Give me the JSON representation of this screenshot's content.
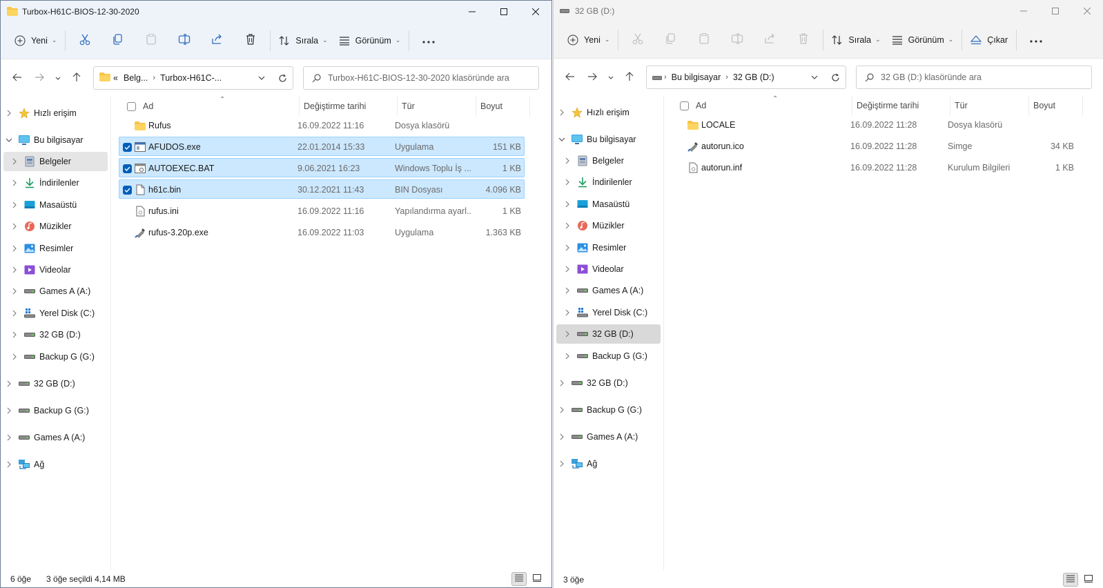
{
  "left": {
    "title": "Turbox-H61C-BIOS-12-30-2020",
    "toolbar": {
      "new_label": "Yeni",
      "sort_label": "Sırala",
      "view_label": "Görünüm"
    },
    "address": {
      "overflow": "«",
      "crumbs": [
        "Belg...",
        "Turbox-H61C-..."
      ]
    },
    "search_placeholder": "Turbox-H61C-BIOS-12-30-2020 klasöründe ara",
    "columns": {
      "name": "Ad",
      "date": "Değiştirme tarihi",
      "type": "Tür",
      "size": "Boyut"
    },
    "tree": [
      {
        "label": "Hızlı erişim",
        "icon": "star-icon",
        "depth": 0,
        "expanded": false
      },
      {
        "label": "Bu bilgisayar",
        "icon": "computer-icon",
        "depth": 0,
        "expanded": true
      },
      {
        "label": "Belgeler",
        "icon": "documents-icon",
        "depth": 1,
        "selected": true
      },
      {
        "label": "İndirilenler",
        "icon": "download-icon",
        "depth": 1
      },
      {
        "label": "Masaüstü",
        "icon": "desktop-icon",
        "depth": 1
      },
      {
        "label": "Müzikler",
        "icon": "music-icon",
        "depth": 1
      },
      {
        "label": "Resimler",
        "icon": "pictures-icon",
        "depth": 1
      },
      {
        "label": "Videolar",
        "icon": "videos-icon",
        "depth": 1
      },
      {
        "label": "Games A (A:)",
        "icon": "drive-icon",
        "depth": 1
      },
      {
        "label": "Yerel Disk (C:)",
        "icon": "windows-drive-icon",
        "depth": 1
      },
      {
        "label": "32 GB (D:)",
        "icon": "drive-icon",
        "depth": 1
      },
      {
        "label": "Backup G (G:)",
        "icon": "drive-icon",
        "depth": 1
      },
      {
        "label": "32 GB (D:)",
        "icon": "drive-icon",
        "depth": 0
      },
      {
        "label": "Backup G (G:)",
        "icon": "drive-icon",
        "depth": 0
      },
      {
        "label": "Games A (A:)",
        "icon": "drive-icon",
        "depth": 0
      },
      {
        "label": "Ağ",
        "icon": "network-icon",
        "depth": 0
      }
    ],
    "files": [
      {
        "name": "Rufus",
        "date": "16.09.2022 11:16",
        "type": "Dosya klasörü",
        "size": "",
        "icon": "folder-icon",
        "selected": false
      },
      {
        "name": "AFUDOS.exe",
        "date": "22.01.2014 15:33",
        "type": "Uygulama",
        "size": "151 KB",
        "icon": "app-icon",
        "selected": true
      },
      {
        "name": "AUTOEXEC.BAT",
        "date": "9.06.2021 16:23",
        "type": "Windows Toplu İş ...",
        "size": "1 KB",
        "icon": "batch-icon",
        "selected": true
      },
      {
        "name": "h61c.bin",
        "date": "30.12.2021 11:43",
        "type": "BIN Dosyası",
        "size": "4.096 KB",
        "icon": "file-icon",
        "selected": true
      },
      {
        "name": "rufus.ini",
        "date": "16.09.2022 11:16",
        "type": "Yapılandırma ayarl...",
        "size": "1 KB",
        "icon": "settings-file-icon",
        "selected": false
      },
      {
        "name": "rufus-3.20p.exe",
        "date": "16.09.2022 11:03",
        "type": "Uygulama",
        "size": "1.363 KB",
        "icon": "usb-app-icon",
        "selected": false
      }
    ],
    "status": {
      "count": "6 öğe",
      "selection": "3 öğe seçildi  4,14 MB"
    }
  },
  "right": {
    "title": "32 GB (D:)",
    "toolbar": {
      "new_label": "Yeni",
      "sort_label": "Sırala",
      "view_label": "Görünüm",
      "eject_label": "Çıkar"
    },
    "address": {
      "crumbs": [
        "Bu bilgisayar",
        "32 GB (D:)"
      ]
    },
    "search_placeholder": "32 GB (D:) klasöründe ara",
    "columns": {
      "name": "Ad",
      "date": "Değiştirme tarihi",
      "type": "Tür",
      "size": "Boyut"
    },
    "tree": [
      {
        "label": "Hızlı erişim",
        "icon": "star-icon",
        "depth": 0
      },
      {
        "label": "Bu bilgisayar",
        "icon": "computer-icon",
        "depth": 0,
        "expanded": true
      },
      {
        "label": "Belgeler",
        "icon": "documents-icon",
        "depth": 1
      },
      {
        "label": "İndirilenler",
        "icon": "download-icon",
        "depth": 1
      },
      {
        "label": "Masaüstü",
        "icon": "desktop-icon",
        "depth": 1
      },
      {
        "label": "Müzikler",
        "icon": "music-icon",
        "depth": 1
      },
      {
        "label": "Resimler",
        "icon": "pictures-icon",
        "depth": 1
      },
      {
        "label": "Videolar",
        "icon": "videos-icon",
        "depth": 1
      },
      {
        "label": "Games A (A:)",
        "icon": "drive-icon",
        "depth": 1
      },
      {
        "label": "Yerel Disk (C:)",
        "icon": "windows-drive-icon",
        "depth": 1
      },
      {
        "label": "32 GB (D:)",
        "icon": "drive-icon",
        "depth": 1,
        "selected": true
      },
      {
        "label": "Backup G (G:)",
        "icon": "drive-icon",
        "depth": 1
      },
      {
        "label": "32 GB (D:)",
        "icon": "drive-icon",
        "depth": 0
      },
      {
        "label": "Backup G (G:)",
        "icon": "drive-icon",
        "depth": 0
      },
      {
        "label": "Games A (A:)",
        "icon": "drive-icon",
        "depth": 0
      },
      {
        "label": "Ağ",
        "icon": "network-icon",
        "depth": 0
      }
    ],
    "files": [
      {
        "name": "LOCALE",
        "date": "16.09.2022 11:28",
        "type": "Dosya klasörü",
        "size": "",
        "icon": "folder-icon",
        "selected": false
      },
      {
        "name": "autorun.ico",
        "date": "16.09.2022 11:28",
        "type": "Simge",
        "size": "34 KB",
        "icon": "usb-app-icon",
        "selected": false
      },
      {
        "name": "autorun.inf",
        "date": "16.09.2022 11:28",
        "type": "Kurulum Bilgileri",
        "size": "1 KB",
        "icon": "settings-file-icon",
        "selected": false
      }
    ],
    "status": {
      "count": "3 öğe"
    }
  }
}
